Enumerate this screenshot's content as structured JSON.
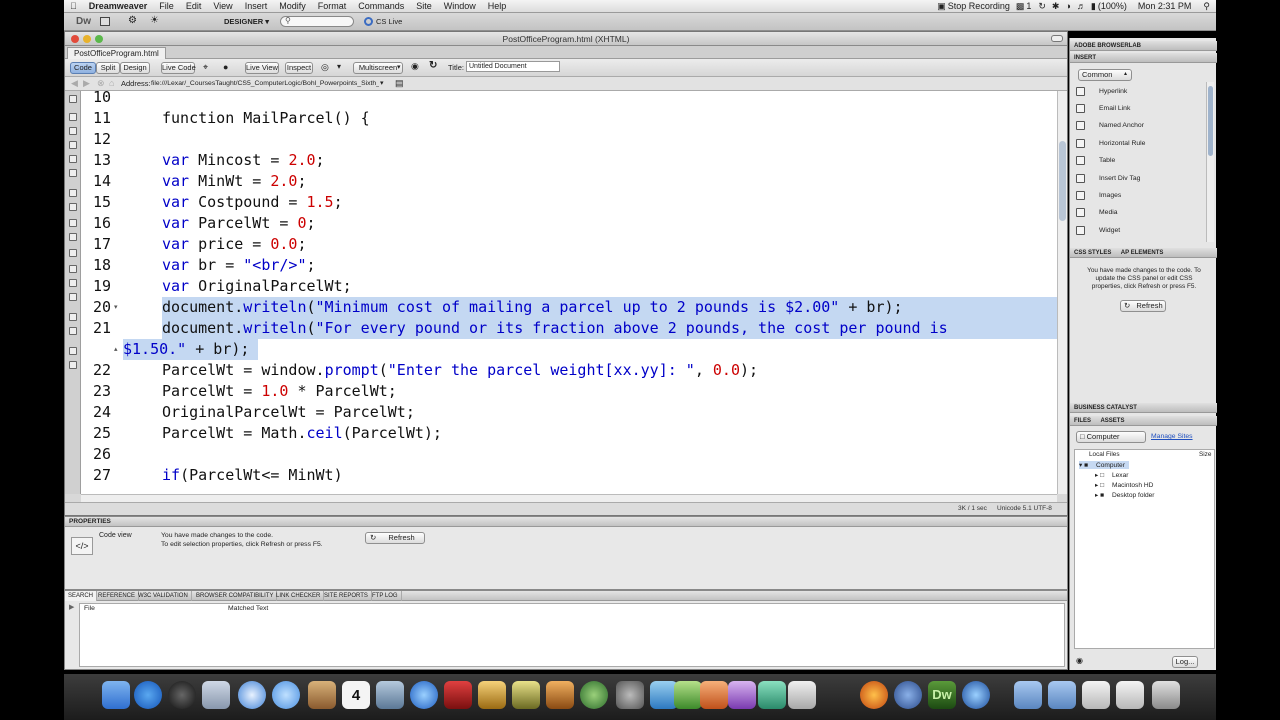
{
  "menubar": {
    "items": [
      "Dreamweaver",
      "File",
      "Edit",
      "View",
      "Insert",
      "Modify",
      "Format",
      "Commands",
      "Site",
      "Window",
      "Help"
    ],
    "stop_recording": "Stop Recording",
    "display_num": "1",
    "battery": "(100%)",
    "clock": "Mon 2:31 PM"
  },
  "appbar": {
    "logo": "Dw",
    "workspace": "DESIGNER ▾",
    "cs_live": "CS Live"
  },
  "document": {
    "window_title": "PostOfficeProgram.html (XHTML)",
    "tab": "PostOfficeProgram.html",
    "view_buttons": [
      "Code",
      "Split",
      "Design",
      "Live Code"
    ],
    "live_view": "Live View",
    "inspect": "Inspect",
    "multiscreen": "Multiscreen",
    "title_label": "Title:",
    "title_value": "Untitled Document",
    "address_label": "Address:",
    "address_value": "file:///Lexar/_CoursesTaught/CS5_ComputerLogic/Bohl_Powerpoints_Sixth_",
    "status_size": "3K / 1 sec",
    "status_encoding": "Unicode 5.1 UTF-8"
  },
  "code": {
    "line_numbers": [
      "10",
      "11",
      "12",
      "13",
      "14",
      "15",
      "16",
      "17",
      "18",
      "19",
      "20",
      "21",
      "22",
      "23",
      "24",
      "25",
      "26",
      "27"
    ],
    "line_11": {
      "a": "function MailParcel() {"
    },
    "line_13": {
      "kw": "var",
      "name": " Mincost = ",
      "num": "2.0",
      "end": ";"
    },
    "line_14": {
      "kw": "var",
      "name": " MinWt = ",
      "num": "2.0",
      "end": ";"
    },
    "line_15": {
      "kw": "var",
      "name": " Costpound = ",
      "num": "1.5",
      "end": ";"
    },
    "line_16": {
      "kw": "var",
      "name": " ParcelWt = ",
      "num": "0",
      "end": ";"
    },
    "line_17": {
      "kw": "var",
      "name": " price = ",
      "num": "0.0",
      "end": ";"
    },
    "line_18": {
      "kw": "var",
      "name": " br = ",
      "str": "\"<br/>\"",
      "end": ";"
    },
    "line_19": {
      "kw": "var",
      "name": " OriginalParcelWt;"
    },
    "line_20": {
      "obj": "document.",
      "fn": "writeln",
      "open": "(",
      "str": "\"Minimum cost of mailing a parcel up to 2 pounds is $2.00\"",
      "rest": " + br);"
    },
    "line_21": {
      "obj": "document.",
      "fn": "writeln",
      "open": "(",
      "str": "\"For every pound or its fraction above 2 pounds, the cost per pound is"
    },
    "line_21b": {
      "str": "$1.50.\"",
      "rest": " + br);"
    },
    "line_22": {
      "a": "ParcelWt = ",
      "obj": "window.",
      "fn": "prompt",
      "open": "(",
      "str": "\"Enter the parcel weight[xx.yy]: \"",
      "mid": ", ",
      "num": "0.0",
      "end": ");"
    },
    "line_23": {
      "a": "ParcelWt = ",
      "num": "1.0",
      "mid": " * ParcelWt;"
    },
    "line_24": {
      "a": "OriginalParcelWt = ParcelWt;"
    },
    "line_25": {
      "a": "ParcelWt = ",
      "obj": "Math.",
      "fn": "ceil",
      "rest": "(ParcelWt);"
    },
    "line_27": {
      "kw": "if",
      "rest": "(ParcelWt<= MinWt)"
    }
  },
  "properties": {
    "header": "PROPERTIES",
    "code_view": "Code view",
    "msg1": "You have made changes to the code.",
    "msg2": "To edit selection properties, click Refresh or press F5.",
    "refresh": "Refresh"
  },
  "results": {
    "tabs": [
      "SEARCH",
      "REFERENCE",
      "W3C VALIDATION",
      "BROWSER COMPATIBILITY",
      "LINK CHECKER",
      "SITE REPORTS",
      "FTP LOG"
    ],
    "col_file": "File",
    "col_matched": "Matched Text"
  },
  "right": {
    "browserlab": "ADOBE BROWSERLAB",
    "insert": "INSERT",
    "category": "Common",
    "items": [
      "Hyperlink",
      "Email Link",
      "Named Anchor",
      "Horizontal Rule",
      "Table",
      "Insert Div Tag",
      "Images",
      "Media",
      "Widget"
    ],
    "css_styles": "CSS STYLES",
    "ap_elements": "AP ELEMENTS",
    "css_msg": "You have made changes to the code. To update the CSS panel or edit CSS properties, click Refresh or press F5.",
    "css_refresh": "Refresh",
    "business_catalyst": "BUSINESS CATALYST",
    "files": "FILES",
    "assets": "ASSETS",
    "location": "Computer",
    "manage_sites": "Manage Sites",
    "local_files": "Local Files",
    "size": "Size",
    "tree": [
      "Computer",
      "Lexar",
      "Macintosh HD",
      "Desktop folder"
    ],
    "log": "Log..."
  }
}
